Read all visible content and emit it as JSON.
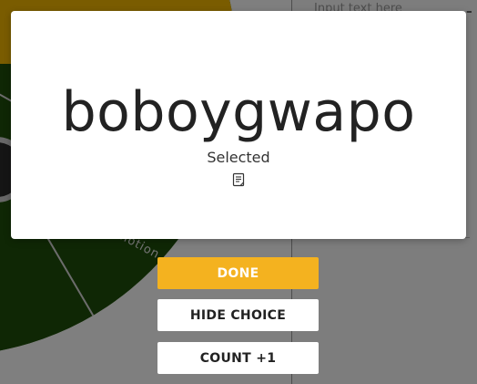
{
  "background": {
    "entries_placeholder": "Input text here",
    "wheel_slice_label": "notion"
  },
  "modal": {
    "winner": "boboygwapo",
    "selected_label": "Selected",
    "note_icon": "note-icon"
  },
  "actions": {
    "done_label": "DONE",
    "hide_label": "HIDE CHOICE",
    "count_label": "COUNT +1"
  },
  "colors": {
    "done_button": "#f4b21f",
    "overlay": "rgba(0,0,0,0.5)",
    "wheel_green": "#2f6b12",
    "wheel_yellow": "#f5b800"
  }
}
